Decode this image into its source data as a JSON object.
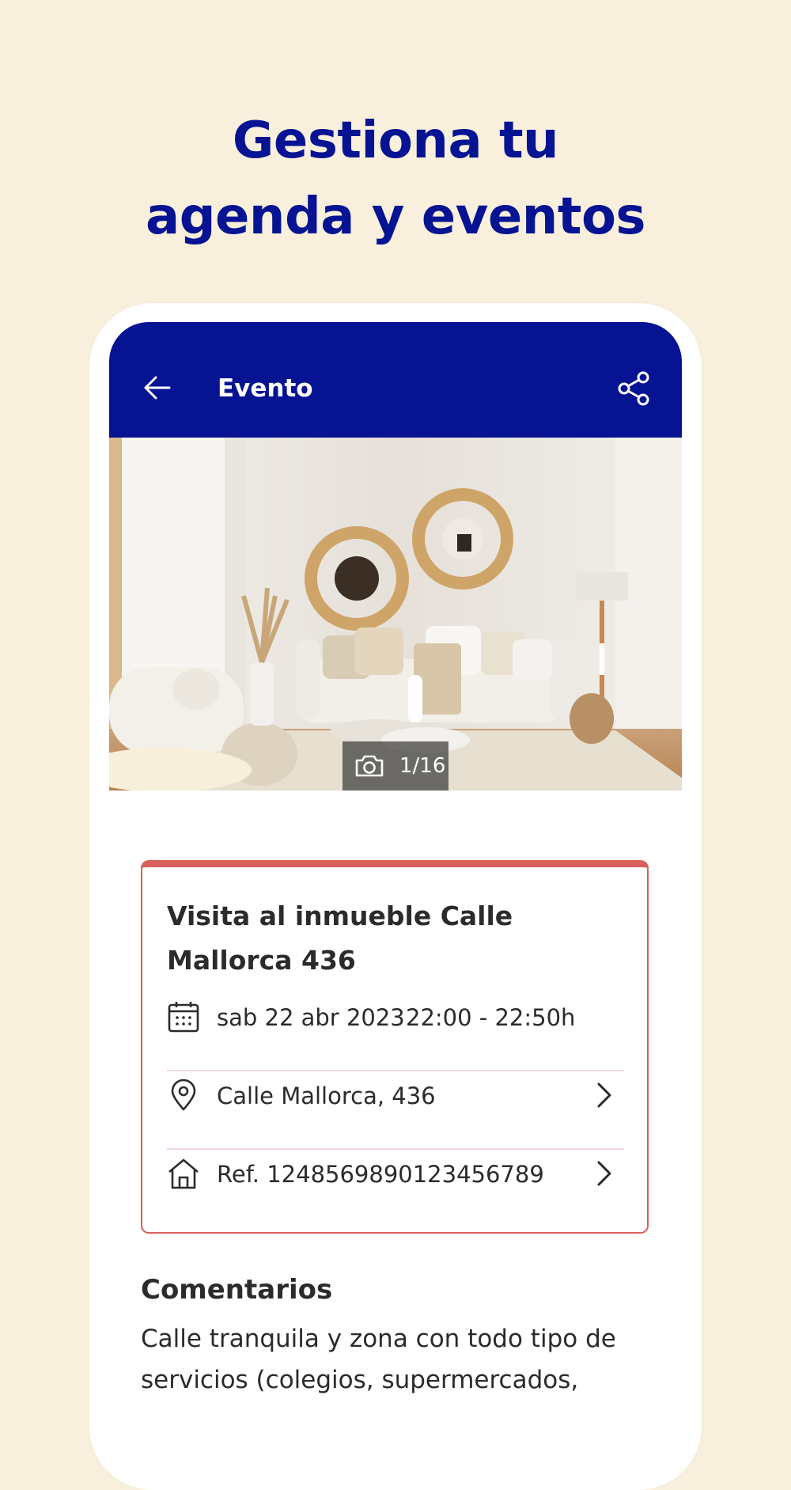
{
  "headline": {
    "line1": "Gestiona tu",
    "line2": "agenda y eventos"
  },
  "appbar": {
    "back_icon": "arrow-left-icon",
    "title": "Evento",
    "share_icon": "share-icon"
  },
  "photo": {
    "counter": "1/16",
    "counter_icon": "camera-icon"
  },
  "event": {
    "title": "Visita al inmueble Calle Mallorca 436",
    "date": "sab 22 abr 2023",
    "time": "22:00 - 22:50h",
    "date_icon": "calendar-icon",
    "address": "Calle Mallorca, 436",
    "address_icon": "location-pin-icon",
    "reference": "Ref. 1248569890123456789",
    "reference_icon": "house-icon"
  },
  "comments": {
    "title": "Comentarios",
    "text": "Calle tranquila y zona con todo tipo de servicios (colegios, supermercados,"
  },
  "colors": {
    "background": "#f8f0dd",
    "brand_blue": "#061392",
    "accent_red": "#d9605c",
    "text": "#2b2b2b"
  }
}
